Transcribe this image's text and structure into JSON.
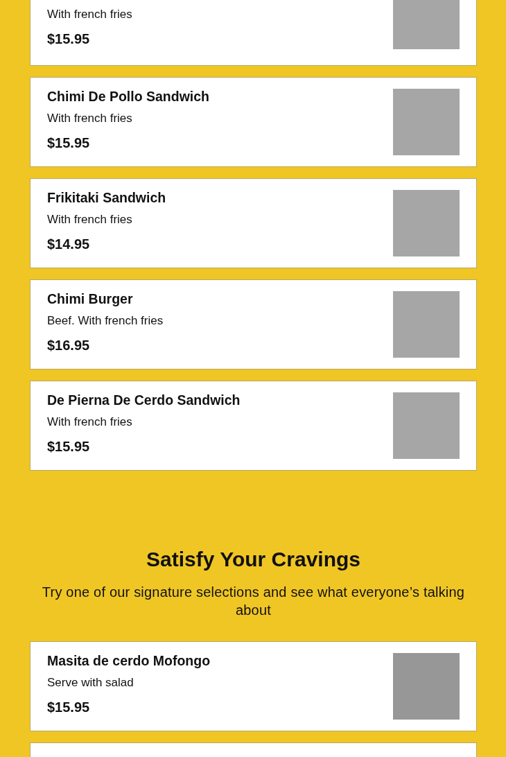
{
  "menu_items": [
    {
      "description": "With french fries",
      "price": "$15.95"
    },
    {
      "title": "Chimi De Pollo Sandwich",
      "description": "With french fries",
      "price": "$15.95"
    },
    {
      "title": "Frikitaki Sandwich",
      "description": "With french fries",
      "price": "$14.95"
    },
    {
      "title": "Chimi Burger",
      "description": "Beef. With french fries",
      "price": "$16.95"
    },
    {
      "title": "De Pierna De Cerdo Sandwich",
      "description": "With french fries",
      "price": "$15.95"
    }
  ],
  "signature_section": {
    "heading": "Satisfy Your Cravings",
    "subheading": "Try one of our signature selections and see what everyone’s talking about",
    "items": [
      {
        "title": "Masita de cerdo Mofongo",
        "description": "Serve with salad",
        "price": "$15.95"
      }
    ]
  }
}
